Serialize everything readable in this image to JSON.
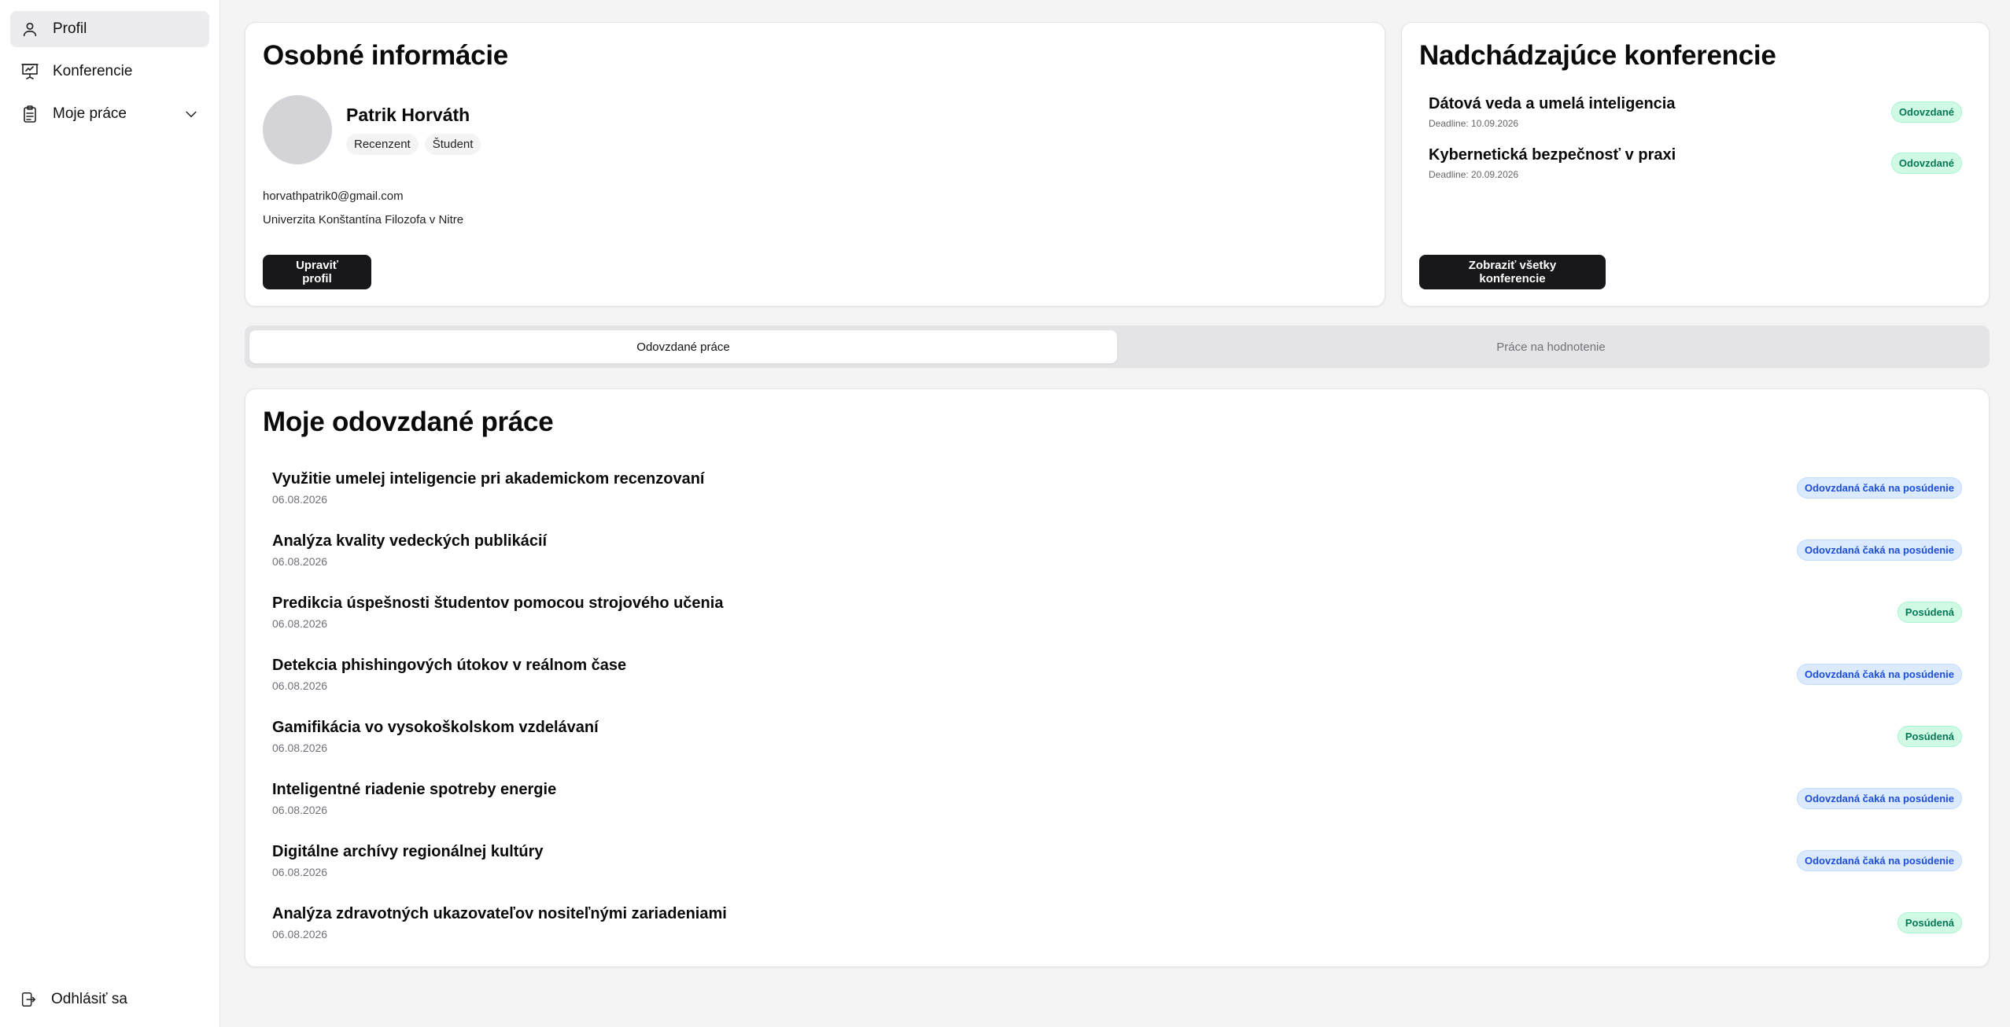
{
  "sidebar": {
    "items": [
      {
        "label": "Profil",
        "icon": "user-icon",
        "active": true
      },
      {
        "label": "Konferencie",
        "icon": "presentation-icon",
        "active": false
      },
      {
        "label": "Moje práce",
        "icon": "clipboard-icon",
        "active": false
      }
    ],
    "logout_label": "Odhlásiť sa"
  },
  "personal": {
    "title": "Osobné informácie",
    "name": "Patrik Horváth",
    "roles": [
      "Recenzent",
      "Študent"
    ],
    "email": "horvathpatrik0@gmail.com",
    "university": "Univerzita Konštantína Filozofa v Nitre",
    "edit_label": "Upraviť profil"
  },
  "conferences": {
    "title": "Nadchádzajúce konferencie",
    "items": [
      {
        "name": "Dátová veda a umelá inteligencia",
        "deadline": "Deadline: 10.09.2026",
        "status": "Odovzdané"
      },
      {
        "name": "Kybernetická bezpečnosť v praxi",
        "deadline": "Deadline: 20.09.2026",
        "status": "Odovzdané"
      }
    ],
    "all_label": "Zobraziť všetky konferencie"
  },
  "tabs": [
    {
      "label": "Odovzdané práce",
      "active": true
    },
    {
      "label": "Práce na hodnotenie",
      "active": false
    }
  ],
  "works": {
    "title": "Moje odovzdané práce",
    "items": [
      {
        "title": "Využitie umelej inteligencie pri akademickom recenzovaní",
        "date": "06.08.2026",
        "status": "Odovzdaná čaká na posúdenie",
        "kind": "blue"
      },
      {
        "title": "Analýza kvality vedeckých publikácií",
        "date": "06.08.2026",
        "status": "Odovzdaná čaká na posúdenie",
        "kind": "blue"
      },
      {
        "title": "Predikcia úspešnosti študentov pomocou strojového učenia",
        "date": "06.08.2026",
        "status": "Posúdená",
        "kind": "green"
      },
      {
        "title": "Detekcia phishingových útokov v reálnom čase",
        "date": "06.08.2026",
        "status": "Odovzdaná čaká na posúdenie",
        "kind": "blue"
      },
      {
        "title": "Gamifikácia vo vysokoškolskom vzdelávaní",
        "date": "06.08.2026",
        "status": "Posúdená",
        "kind": "green"
      },
      {
        "title": "Inteligentné riadenie spotreby energie",
        "date": "06.08.2026",
        "status": "Odovzdaná čaká na posúdenie",
        "kind": "blue"
      },
      {
        "title": "Digitálne archívy regionálnej kultúry",
        "date": "06.08.2026",
        "status": "Odovzdaná čaká na posúdenie",
        "kind": "blue"
      },
      {
        "title": "Analýza zdravotných ukazovateľov nositeľnými zariadeniami",
        "date": "06.08.2026",
        "status": "Posúdená",
        "kind": "green"
      }
    ]
  },
  "colors": {
    "accent_dark": "#18181b",
    "status_green_bg": "#d1fae5",
    "status_green_text": "#047857",
    "status_blue_bg": "#dbeafe",
    "status_blue_text": "#1d4ed8"
  }
}
